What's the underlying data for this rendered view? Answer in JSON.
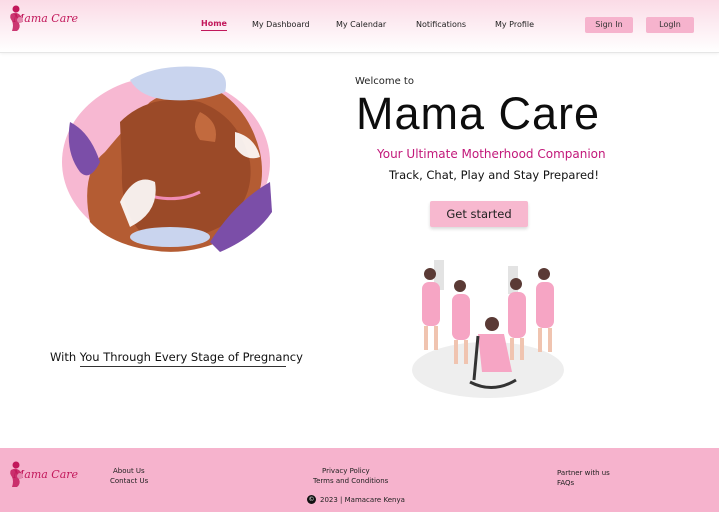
{
  "brand": {
    "name": "Mama Care"
  },
  "nav": {
    "home": "Home",
    "dashboard": "My Dashboard",
    "calendar": "My Calendar",
    "notifications": "Notifications",
    "profile": "My Profile",
    "sign_in": "Sign In",
    "login": "LogIn"
  },
  "hero": {
    "welcome": "Welcome to",
    "title": "Mama Care",
    "tagline": "Your Ultimate Motherhood Companion",
    "subline": "Track, Chat, Play and Stay Prepared!",
    "cta": "Get started",
    "stage_text": "With You Through Every Stage of Pregnancy"
  },
  "footer": {
    "about": "About Us",
    "contact": "Contact Us",
    "privacy": "Privacy Policy",
    "terms": "Terms and Conditions",
    "partner": "Partner with us",
    "faqs": "FAQs",
    "copyright": "2023 | Mamacare Kenya"
  },
  "colors": {
    "accent": "#c2185b",
    "pink_button": "#f6b3cd",
    "footer_bg": "#f6b3cd",
    "tagline": "#c2187a"
  },
  "icons": [
    "mother-logo-icon",
    "copyright-icon"
  ]
}
